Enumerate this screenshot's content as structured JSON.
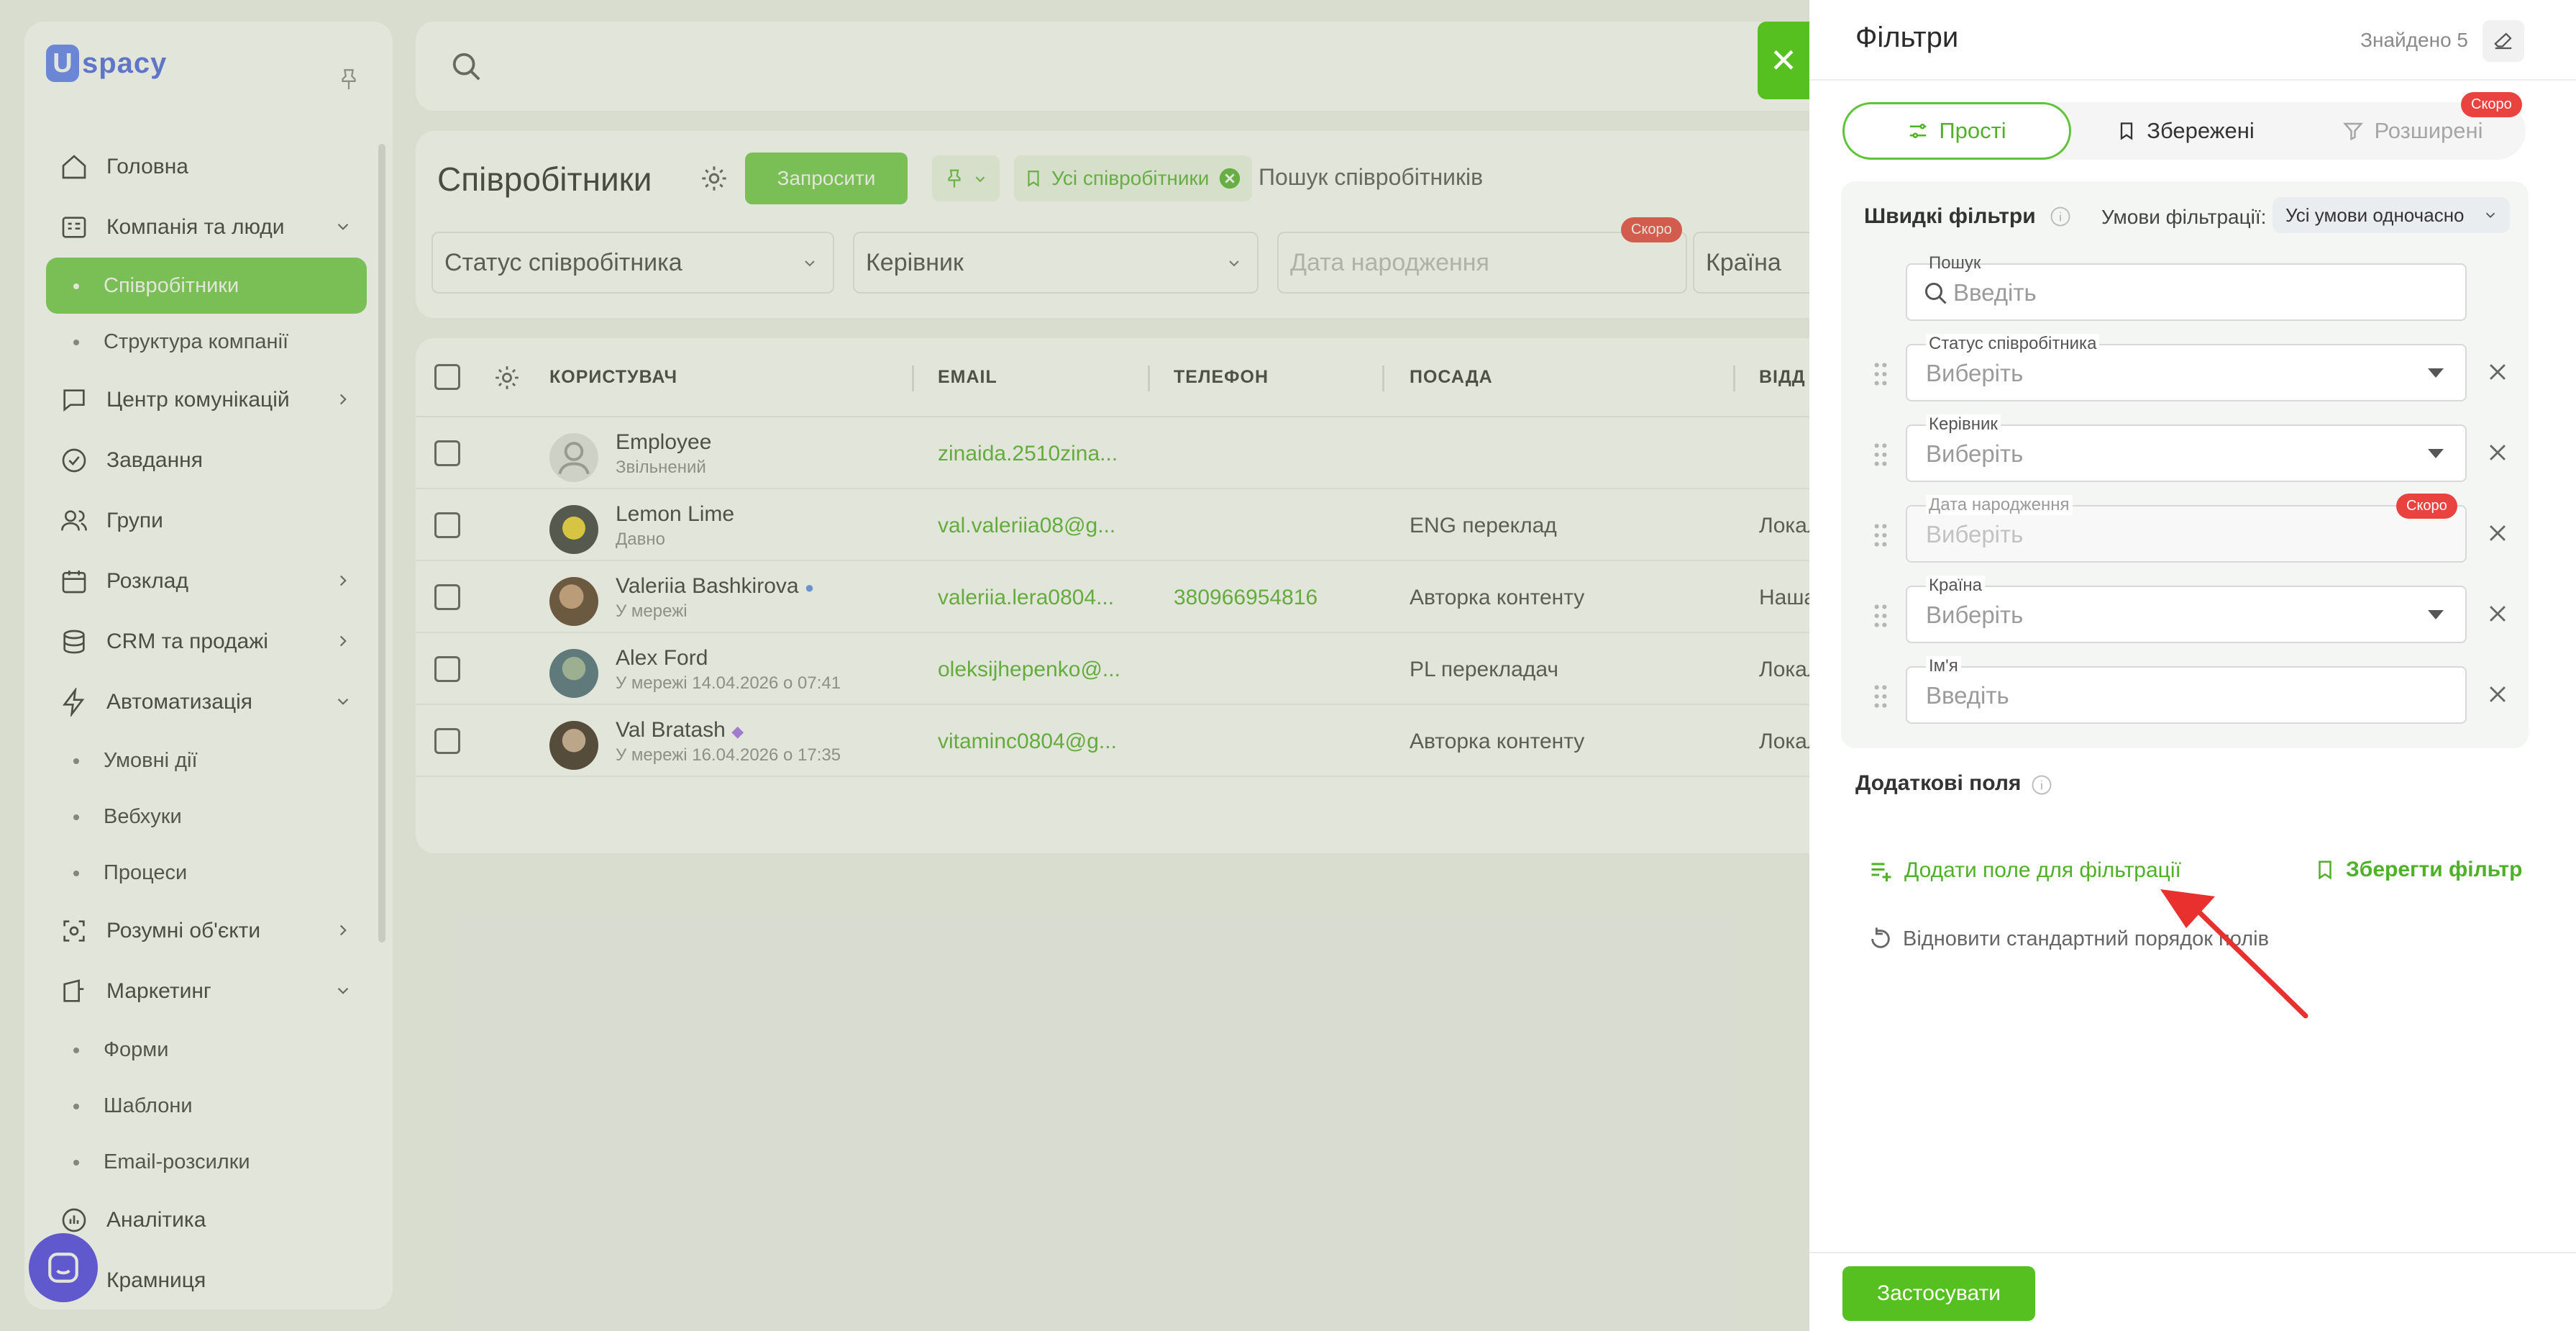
{
  "colors": {
    "accent": "#57c021",
    "accent_light": "#6fc94a",
    "badge_red": "#e9423f",
    "brand_blue": "#4b63e8",
    "arrow_red": "#e8312f"
  },
  "sidebar": {
    "logo_mark": "U",
    "logo_text": "spacy",
    "items": [
      {
        "label": "Головна",
        "icon": "home-icon"
      },
      {
        "label": "Компанія та люди",
        "icon": "company-icon"
      },
      {
        "label": "Співробітники",
        "sub": true,
        "active": true
      },
      {
        "label": "Структура компанії",
        "sub": true
      },
      {
        "label": "Центр комунікацій",
        "icon": "chat-icon"
      },
      {
        "label": "Завдання",
        "icon": "check-circle-icon"
      },
      {
        "label": "Групи",
        "icon": "users-icon"
      },
      {
        "label": "Розклад",
        "icon": "calendar-icon"
      },
      {
        "label": "CRM та продажі",
        "icon": "database-icon"
      },
      {
        "label": "Автоматизація",
        "icon": "lightning-icon"
      },
      {
        "label": "Умовні дії",
        "sub": true
      },
      {
        "label": "Вебхуки",
        "sub": true
      },
      {
        "label": "Процеси",
        "sub": true
      },
      {
        "label": "Розумні об'єкти",
        "icon": "smart-object-icon"
      },
      {
        "label": "Маркетинг",
        "icon": "marketing-icon"
      },
      {
        "label": "Форми",
        "sub": true
      },
      {
        "label": "Шаблони",
        "sub": true
      },
      {
        "label": "Email-розсилки",
        "sub": true
      },
      {
        "label": "Аналітика",
        "icon": "analytics-icon"
      },
      {
        "label": "Крамниця",
        "icon": "shop-icon"
      }
    ]
  },
  "main": {
    "title": "Співробітники",
    "invite_label": "Запросити",
    "chip_label": "Усі співробітники",
    "search_placeholder": "Пошук співробітників",
    "filters": [
      "Статус співробітника",
      "Керівник",
      "Дата народження",
      "Країна"
    ],
    "soon_badge": "Скоро"
  },
  "table": {
    "headers": [
      "КОРИСТУВАЧ",
      "EMAIL",
      "ТЕЛЕФОН",
      "ПОСАДА",
      "ВІДД"
    ],
    "rows": [
      {
        "name": "Employee",
        "status": "Звільнений",
        "email": "zinaida.2510zina...",
        "phone": "",
        "position": "",
        "dept": ""
      },
      {
        "name": "Lemon Lime",
        "status": "Давно",
        "email": "val.valeriia08@g...",
        "phone": "",
        "position": "ENG переклад",
        "dept": "Локалі"
      },
      {
        "name": "Valeriia Bashkirova",
        "status": "У мережі",
        "email": "valeriia.lera0804...",
        "phone": "380966954816",
        "position": "Авторка контенту",
        "dept": "Наша к"
      },
      {
        "name": "Alex Ford",
        "status": "У мережі 14.04.2026 о 07:41",
        "email": "oleksijhepenko@...",
        "phone": "",
        "position": "PL перекладач",
        "dept": "Локалі"
      },
      {
        "name": "Val Bratash",
        "status": "У мережі 16.04.2026 о 17:35",
        "email": "vitaminc0804@g...",
        "phone": "",
        "position": "Авторка контенту",
        "dept": "Локалі"
      }
    ]
  },
  "drawer": {
    "title": "Фільтри",
    "found": "Знайдено 5",
    "tabs": [
      "Прості",
      "Збережені",
      "Розширені"
    ],
    "soon_badge": "Скоро",
    "quick_title": "Швидкі фільтри",
    "conditions_label": "Умови фільтрації:",
    "conditions_value": "Усі умови одночасно",
    "fields": [
      {
        "label": "Пошук",
        "placeholder": "Введіть"
      },
      {
        "label": "Статус співробітника",
        "placeholder": "Виберіть"
      },
      {
        "label": "Керівник",
        "placeholder": "Виберіть"
      },
      {
        "label": "Дата народження",
        "placeholder": "Виберіть"
      },
      {
        "label": "Країна",
        "placeholder": "Виберіть"
      },
      {
        "label": "Ім'я",
        "placeholder": "Введіть"
      }
    ],
    "extra_title": "Додаткові поля",
    "add_field_label": "Додати поле для фільтрації",
    "save_filter_label": "Зберегти фільтр",
    "restore_label": "Відновити стандартний порядок полів",
    "apply_label": "Застосувати"
  }
}
